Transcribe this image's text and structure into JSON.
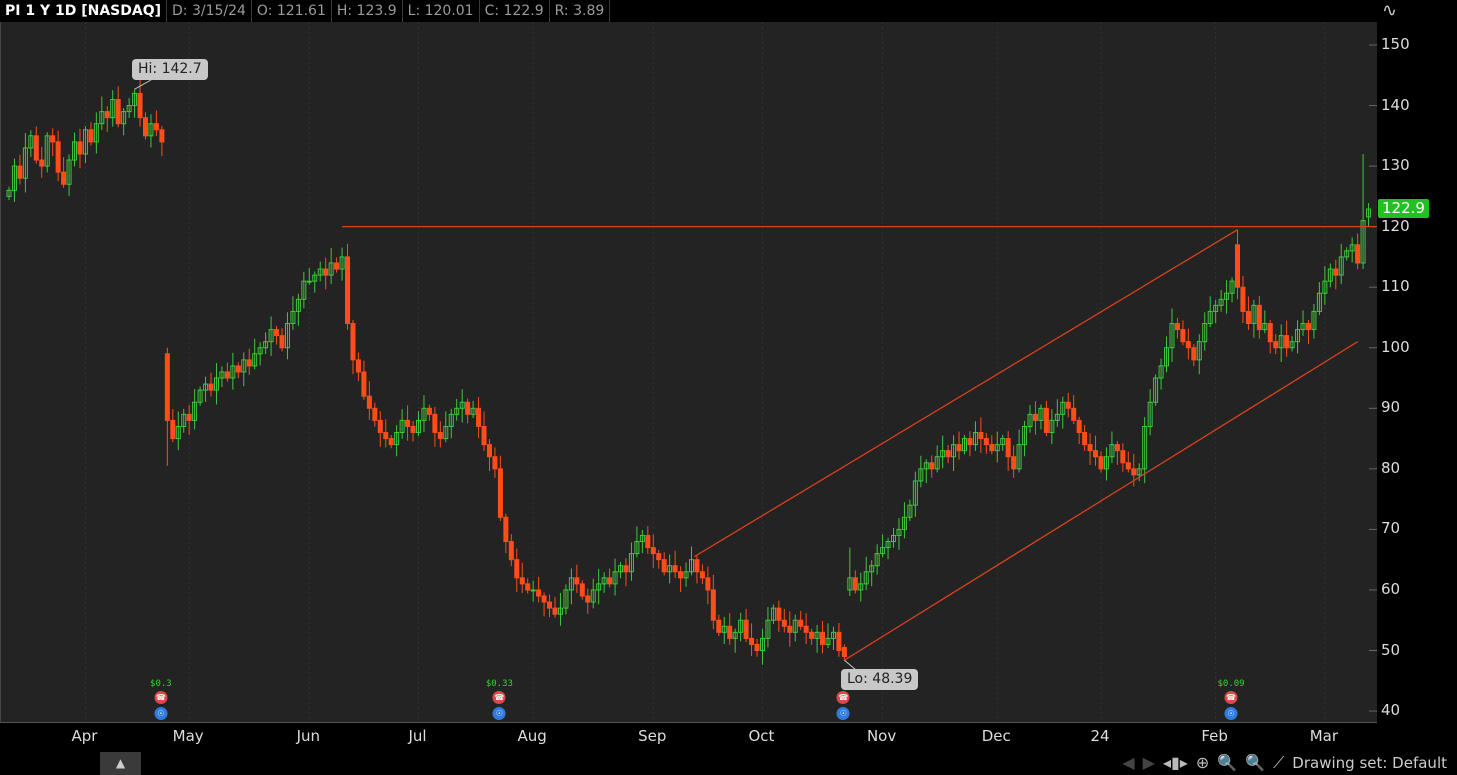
{
  "header": {
    "symbol": "PI 1 Y 1D [NASDAQ]",
    "date": "D: 3/15/24",
    "open": "O: 121.61",
    "high": "H: 123.9",
    "low": "L: 120.01",
    "close": "C: 122.9",
    "range": "R: 3.89"
  },
  "last_price_label": "122.9",
  "hi_label": "Hi: 142.7",
  "lo_label": "Lo: 48.39",
  "events": [
    {
      "bar": 28,
      "dividend": "$0.3"
    },
    {
      "bar": 90,
      "dividend": "$0.33"
    },
    {
      "bar": 153,
      "dividend": ""
    },
    {
      "bar": 224,
      "dividend": "$0.09"
    }
  ],
  "toolbar": {
    "drawing_set": "Drawing set: Default"
  },
  "colors": {
    "up": "#3ec83e",
    "down": "#ff4d1a",
    "drawing": "#d8401c",
    "bg": "#232323"
  },
  "chart_data": {
    "type": "candlestick",
    "title": "PI 1 Y 1D [NASDAQ]",
    "ylim": [
      38,
      155
    ],
    "y_ticks": [
      "150",
      "140",
      "130",
      "120",
      "110",
      "100",
      "90",
      "80",
      "70",
      "60",
      "50",
      "40"
    ],
    "x_ticks": [
      {
        "label": "Apr",
        "bar": 14
      },
      {
        "label": "May",
        "bar": 33
      },
      {
        "label": "Jun",
        "bar": 55
      },
      {
        "label": "Jul",
        "bar": 75
      },
      {
        "label": "Aug",
        "bar": 96
      },
      {
        "label": "Sep",
        "bar": 118
      },
      {
        "label": "Oct",
        "bar": 138
      },
      {
        "label": "Nov",
        "bar": 160
      },
      {
        "label": "Dec",
        "bar": 181
      },
      {
        "label": "24",
        "bar": 200
      },
      {
        "label": "Feb",
        "bar": 221
      },
      {
        "label": "Mar",
        "bar": 241
      }
    ],
    "closes": [
      126,
      130,
      128,
      133,
      135,
      131,
      130,
      135,
      134,
      129,
      127,
      131,
      134,
      132,
      136,
      134,
      137,
      139,
      138,
      141,
      137,
      139,
      140,
      142,
      138,
      135,
      137,
      136,
      134,
      88,
      85,
      87,
      89,
      88,
      91,
      93,
      94,
      93,
      95,
      96,
      95,
      97,
      96,
      98,
      97,
      99,
      100,
      101,
      103,
      102,
      100,
      104,
      106,
      108,
      111,
      111,
      112,
      113,
      112,
      114,
      113,
      115,
      104,
      98,
      96,
      92,
      90,
      88,
      86,
      85,
      84,
      86,
      88,
      87,
      86,
      88,
      90,
      89,
      86,
      85,
      87,
      89,
      90,
      91,
      89,
      90,
      87,
      84,
      82,
      80,
      72,
      68,
      65,
      62,
      61,
      60,
      60,
      59,
      58,
      57,
      56,
      57,
      60,
      62,
      61,
      59,
      58,
      60,
      61,
      62,
      61,
      63,
      64,
      63,
      66,
      68,
      69,
      67,
      66,
      65,
      63,
      64,
      63,
      62,
      63,
      65,
      63,
      62,
      60,
      55,
      53,
      54,
      52,
      53,
      55,
      52,
      51,
      50,
      52,
      55,
      57,
      55,
      54,
      53,
      55,
      54,
      53,
      52,
      53,
      51,
      52,
      53,
      50,
      49,
      62,
      60,
      61,
      63,
      64,
      66,
      67,
      68,
      69,
      70,
      72,
      74,
      78,
      80,
      81,
      80,
      82,
      83,
      82,
      84,
      83,
      85,
      84,
      86,
      85,
      84,
      83,
      84,
      85,
      82,
      80,
      84,
      87,
      89,
      88,
      90,
      86,
      88,
      89,
      91,
      90,
      88,
      86,
      84,
      83,
      82,
      80,
      82,
      84,
      83,
      81,
      80,
      79,
      80,
      87,
      91,
      95,
      97,
      100,
      104,
      103,
      101,
      100,
      98,
      101,
      104,
      106,
      107,
      108,
      109,
      111,
      110,
      106,
      104,
      107,
      103,
      104,
      101,
      100,
      102,
      100,
      101,
      103,
      104,
      103,
      106,
      109,
      111,
      113,
      112,
      115,
      116,
      117,
      114,
      121,
      122.9
    ],
    "ohlc_overrides": {
      "23": [
        140,
        142.7,
        138,
        142
      ],
      "29": [
        99,
        100,
        80.5,
        88
      ],
      "153": [
        50.5,
        51,
        48.39,
        49
      ],
      "154": [
        60,
        67,
        59,
        62
      ],
      "225": [
        117,
        119.5,
        108,
        110
      ],
      "248": [
        114,
        132,
        113,
        121
      ],
      "249": [
        121.61,
        123.9,
        120.01,
        122.9
      ]
    },
    "drawings": [
      {
        "type": "horizontal",
        "price": 120,
        "from_bar": 61
      },
      {
        "type": "trendline",
        "from_bar": 125.5,
        "from_price": 65.5,
        "to_bar": 225,
        "to_price": 119.5
      },
      {
        "type": "trendline",
        "from_bar": 153,
        "from_price": 48.4,
        "to_bar": 247,
        "to_price": 101
      }
    ]
  }
}
